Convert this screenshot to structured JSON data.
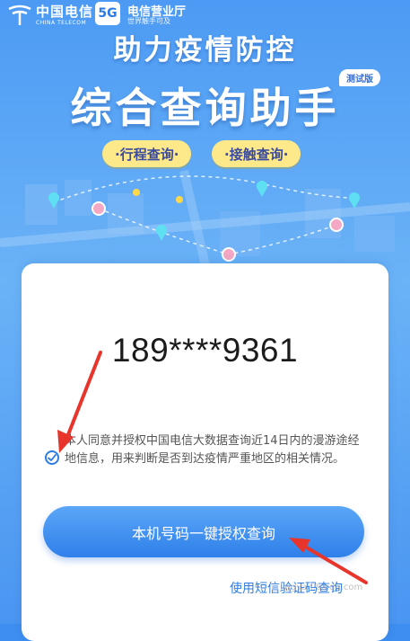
{
  "header": {
    "carrier_name": "中国电信",
    "carrier_en": "CHINA TELECOM",
    "badge_5g": "5G",
    "hall_name": "电信营业厅",
    "hall_slogan": "世界触手可及"
  },
  "hero": {
    "title_line1": "助力疫情防控",
    "title_line2": "综合查询助手",
    "beta_tag": "测试版",
    "tab_itinerary": "·行程查询·",
    "tab_contact": "·接触查询·"
  },
  "form": {
    "phone_masked": "189****9361",
    "consent_checked": true,
    "consent_text": "本人同意并授权中国电信大数据查询近14日内的漫游途经地信息，用来判断是否到达疫情严重地区的相关情况。",
    "one_click_button": "本机号码一键授权查询",
    "sms_link": "使用短信验证码查询"
  },
  "colors": {
    "brand_blue": "#2f80ea",
    "pill_yellow": "#fde98a",
    "annotation_red": "#e8352b"
  },
  "watermark": "jingyan.baidu.com"
}
